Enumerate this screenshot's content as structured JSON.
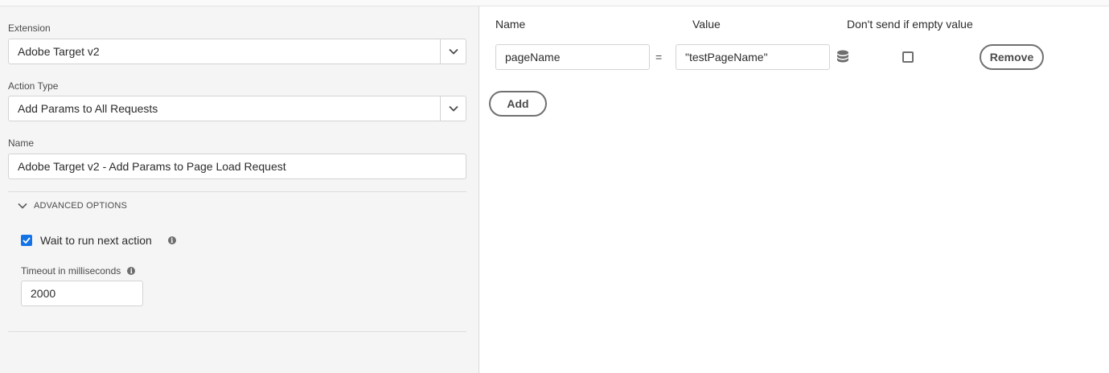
{
  "left_panel": {
    "extension": {
      "label": "Extension",
      "value": "Adobe Target v2"
    },
    "action_type": {
      "label": "Action Type",
      "value": "Add Params to All Requests"
    },
    "name": {
      "label": "Name",
      "value": "Adobe Target v2 - Add Params to Page Load Request"
    },
    "advanced_options": {
      "label": "ADVANCED OPTIONS",
      "expanded": true,
      "wait_checkbox": {
        "label": "Wait to run next action",
        "checked": true
      },
      "timeout": {
        "label": "Timeout in milliseconds",
        "value": "2000"
      }
    }
  },
  "params_table": {
    "headers": {
      "name": "Name",
      "value": "Value",
      "dont_send": "Don't send if empty value"
    },
    "rows": [
      {
        "name": "pageName",
        "equals": "=",
        "value": "\"testPageName\"",
        "dont_send_checked": false,
        "remove_label": "Remove"
      }
    ],
    "add_label": "Add"
  },
  "icons": {
    "dropdown": "chevron-down-icon",
    "advanced_toggle": "chevron-down-icon",
    "info": "info-icon",
    "data_element": "database-icon"
  },
  "colors": {
    "accent": "#1473e6",
    "panel_bg": "#f5f5f5",
    "border": "#d3d3d3"
  }
}
